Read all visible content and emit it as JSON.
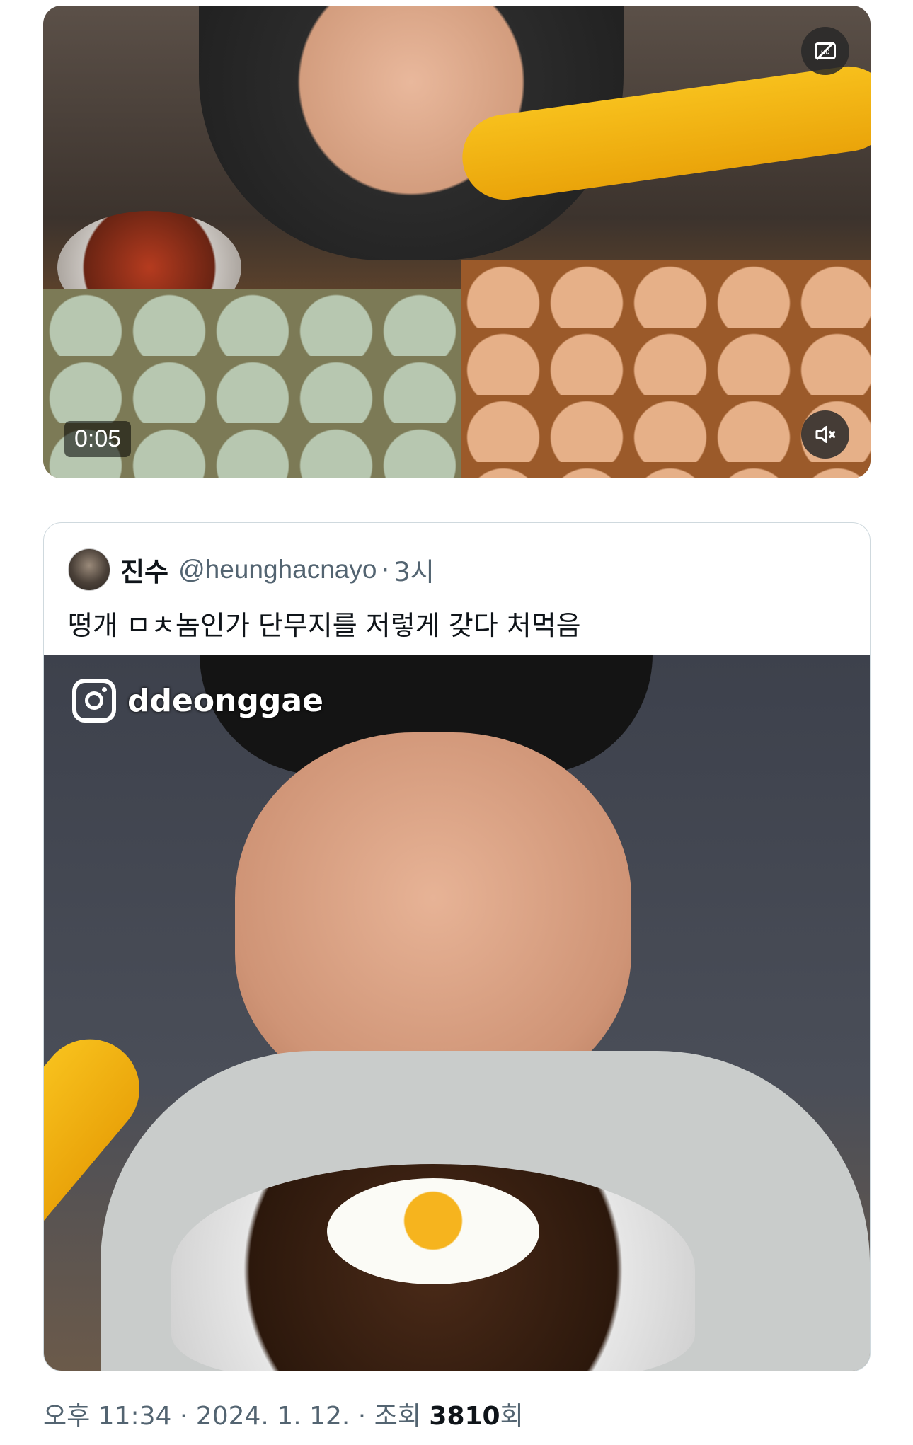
{
  "video": {
    "time": "0:05",
    "cc_icon": "captions-off-icon",
    "mute_icon": "muted-speaker-icon"
  },
  "quote": {
    "name": "진수",
    "handle": "@heunghacnayo",
    "separator": "·",
    "time": "3시",
    "text": "떵개 ㅁㅊ놈인가 단무지를 저렇게 갖다 처먹음",
    "media": {
      "watermark": "ddeonggae"
    }
  },
  "footer": {
    "time": "오후 11:34",
    "sep1": "·",
    "date": "2024. 1. 12.",
    "sep2": "·",
    "views_label": "조회",
    "views_count": "3810",
    "views_suffix": "회"
  }
}
